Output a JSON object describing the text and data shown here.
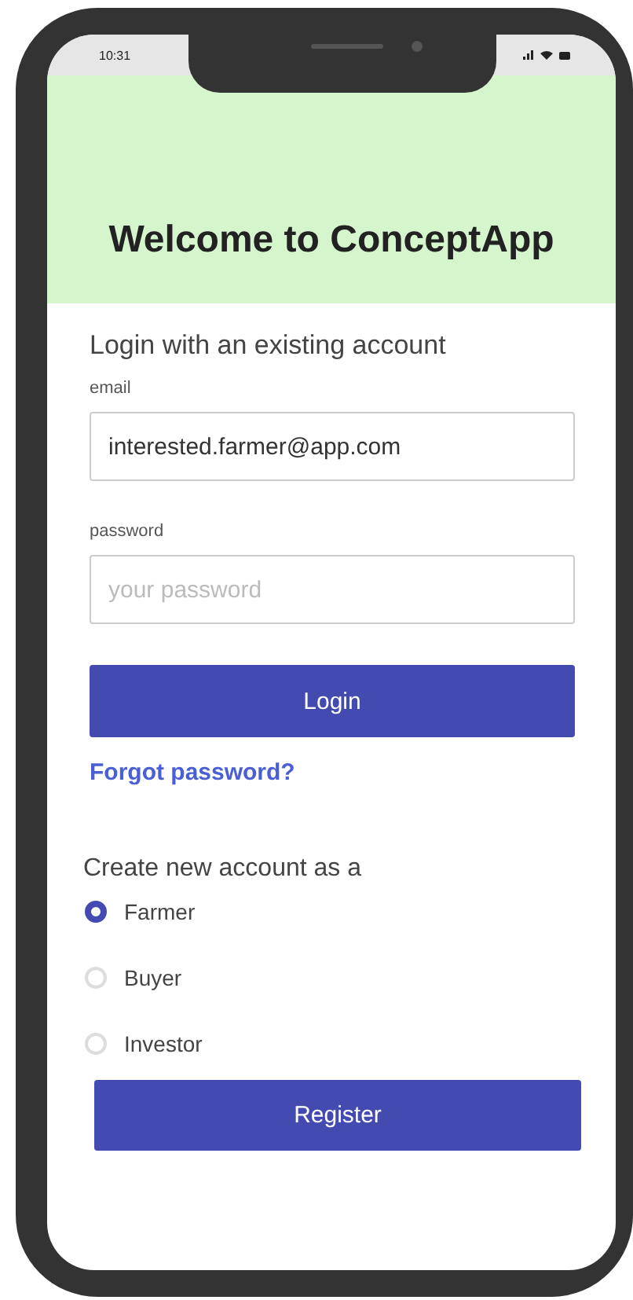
{
  "status_bar": {
    "time": "10:31"
  },
  "header": {
    "title": "Welcome to ConceptApp"
  },
  "login": {
    "heading": "Login with an existing account",
    "fields": [
      {
        "label": "email",
        "value": "interested.farmer@app.com"
      },
      {
        "label": "password",
        "placeholder": "your password"
      }
    ],
    "button": "Login",
    "forgot_link": "Forgot password?"
  },
  "register": {
    "heading": "Create new account as a",
    "roles": [
      {
        "label": "Farmer",
        "selected": true
      },
      {
        "label": "Buyer",
        "selected": false
      },
      {
        "label": "Investor",
        "selected": false
      }
    ],
    "button": "Register"
  }
}
